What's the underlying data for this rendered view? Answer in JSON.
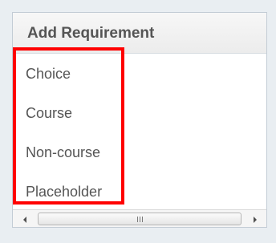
{
  "panel": {
    "title": "Add Requirement",
    "items": [
      {
        "label": "Choice"
      },
      {
        "label": "Course"
      },
      {
        "label": "Non-course"
      },
      {
        "label": "Placeholder"
      }
    ],
    "highlight_color": "#ff0000"
  },
  "scrollbar": {
    "left_icon": "scroll-left-arrow-icon",
    "right_icon": "scroll-right-arrow-icon",
    "thumb_icon": "grip-icon"
  }
}
